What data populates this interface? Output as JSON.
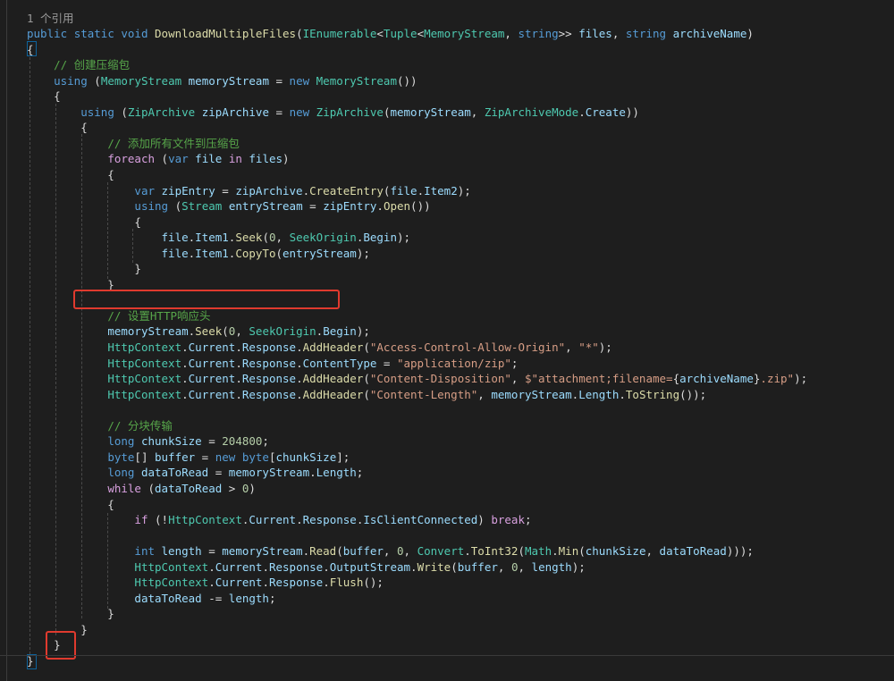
{
  "editor": {
    "codelens": "1 个引用",
    "accent": "#e03a2e",
    "lines": [
      [
        [
          "kw",
          "public"
        ],
        [
          "pl",
          " "
        ],
        [
          "kw",
          "static"
        ],
        [
          "pl",
          " "
        ],
        [
          "kw",
          "void"
        ],
        [
          "pl",
          " "
        ],
        [
          "fn",
          "DownloadMultipleFiles"
        ],
        [
          "pl",
          "("
        ],
        [
          "ty",
          "IEnumerable"
        ],
        [
          "pl",
          "<"
        ],
        [
          "ty",
          "Tuple"
        ],
        [
          "pl",
          "<"
        ],
        [
          "ty",
          "MemoryStream"
        ],
        [
          "pl",
          ", "
        ],
        [
          "kw",
          "string"
        ],
        [
          "pl",
          ">> "
        ],
        [
          "var",
          "files"
        ],
        [
          "pl",
          ", "
        ],
        [
          "kw",
          "string"
        ],
        [
          "pl",
          " "
        ],
        [
          "var",
          "archiveName"
        ],
        [
          "pl",
          ")"
        ]
      ],
      [
        [
          "pl",
          "{"
        ]
      ],
      [
        [
          "pl",
          "    "
        ],
        [
          "cm",
          "// 创建压缩包"
        ]
      ],
      [
        [
          "pl",
          "    "
        ],
        [
          "kw",
          "using"
        ],
        [
          "pl",
          " ("
        ],
        [
          "ty",
          "MemoryStream"
        ],
        [
          "pl",
          " "
        ],
        [
          "var",
          "memoryStream"
        ],
        [
          "pl",
          " = "
        ],
        [
          "kw",
          "new"
        ],
        [
          "pl",
          " "
        ],
        [
          "ty",
          "MemoryStream"
        ],
        [
          "pl",
          "())"
        ]
      ],
      [
        [
          "pl",
          "    {"
        ]
      ],
      [
        [
          "pl",
          "        "
        ],
        [
          "kw",
          "using"
        ],
        [
          "pl",
          " ("
        ],
        [
          "ty",
          "ZipArchive"
        ],
        [
          "pl",
          " "
        ],
        [
          "var",
          "zipArchive"
        ],
        [
          "pl",
          " = "
        ],
        [
          "kw",
          "new"
        ],
        [
          "pl",
          " "
        ],
        [
          "ty",
          "ZipArchive"
        ],
        [
          "pl",
          "("
        ],
        [
          "var",
          "memoryStream"
        ],
        [
          "pl",
          ", "
        ],
        [
          "ty",
          "ZipArchiveMode"
        ],
        [
          "pl",
          "."
        ],
        [
          "var",
          "Create"
        ],
        [
          "pl",
          "))"
        ]
      ],
      [
        [
          "pl",
          "        {"
        ]
      ],
      [
        [
          "pl",
          "            "
        ],
        [
          "cm",
          "// 添加所有文件到压缩包"
        ]
      ],
      [
        [
          "pl",
          "            "
        ],
        [
          "ctl",
          "foreach"
        ],
        [
          "pl",
          " ("
        ],
        [
          "kw",
          "var"
        ],
        [
          "pl",
          " "
        ],
        [
          "var",
          "file"
        ],
        [
          "pl",
          " "
        ],
        [
          "ctl",
          "in"
        ],
        [
          "pl",
          " "
        ],
        [
          "var",
          "files"
        ],
        [
          "pl",
          ")"
        ]
      ],
      [
        [
          "pl",
          "            {"
        ]
      ],
      [
        [
          "pl",
          "                "
        ],
        [
          "kw",
          "var"
        ],
        [
          "pl",
          " "
        ],
        [
          "var",
          "zipEntry"
        ],
        [
          "pl",
          " = "
        ],
        [
          "var",
          "zipArchive"
        ],
        [
          "pl",
          "."
        ],
        [
          "fn",
          "CreateEntry"
        ],
        [
          "pl",
          "("
        ],
        [
          "var",
          "file"
        ],
        [
          "pl",
          "."
        ],
        [
          "var",
          "Item2"
        ],
        [
          "pl",
          ");"
        ]
      ],
      [
        [
          "pl",
          "                "
        ],
        [
          "kw",
          "using"
        ],
        [
          "pl",
          " ("
        ],
        [
          "ty",
          "Stream"
        ],
        [
          "pl",
          " "
        ],
        [
          "var",
          "entryStream"
        ],
        [
          "pl",
          " = "
        ],
        [
          "var",
          "zipEntry"
        ],
        [
          "pl",
          "."
        ],
        [
          "fn",
          "Open"
        ],
        [
          "pl",
          "())"
        ]
      ],
      [
        [
          "pl",
          "                {"
        ]
      ],
      [
        [
          "pl",
          "                    "
        ],
        [
          "var",
          "file"
        ],
        [
          "pl",
          "."
        ],
        [
          "var",
          "Item1"
        ],
        [
          "pl",
          "."
        ],
        [
          "fn",
          "Seek"
        ],
        [
          "pl",
          "("
        ],
        [
          "num",
          "0"
        ],
        [
          "pl",
          ", "
        ],
        [
          "ty",
          "SeekOrigin"
        ],
        [
          "pl",
          "."
        ],
        [
          "var",
          "Begin"
        ],
        [
          "pl",
          ");"
        ]
      ],
      [
        [
          "pl",
          "                    "
        ],
        [
          "var",
          "file"
        ],
        [
          "pl",
          "."
        ],
        [
          "var",
          "Item1"
        ],
        [
          "pl",
          "."
        ],
        [
          "fn",
          "CopyTo"
        ],
        [
          "pl",
          "("
        ],
        [
          "var",
          "entryStream"
        ],
        [
          "pl",
          ");"
        ]
      ],
      [
        [
          "pl",
          "                }"
        ]
      ],
      [
        [
          "pl",
          "            }"
        ]
      ],
      [
        [
          "pl",
          "        "
        ]
      ],
      [
        [
          "pl",
          "            "
        ],
        [
          "cm",
          "// 设置HTTP响应头"
        ]
      ],
      [
        [
          "pl",
          "            "
        ],
        [
          "var",
          "memoryStream"
        ],
        [
          "pl",
          "."
        ],
        [
          "fn",
          "Seek"
        ],
        [
          "pl",
          "("
        ],
        [
          "num",
          "0"
        ],
        [
          "pl",
          ", "
        ],
        [
          "ty",
          "SeekOrigin"
        ],
        [
          "pl",
          "."
        ],
        [
          "var",
          "Begin"
        ],
        [
          "pl",
          ");"
        ]
      ],
      [
        [
          "pl",
          "            "
        ],
        [
          "ty",
          "HttpContext"
        ],
        [
          "pl",
          "."
        ],
        [
          "var",
          "Current"
        ],
        [
          "pl",
          "."
        ],
        [
          "var",
          "Response"
        ],
        [
          "pl",
          "."
        ],
        [
          "fn",
          "AddHeader"
        ],
        [
          "pl",
          "("
        ],
        [
          "str",
          "\"Access-Control-Allow-Origin\""
        ],
        [
          "pl",
          ", "
        ],
        [
          "str",
          "\"*\""
        ],
        [
          "pl",
          ");"
        ]
      ],
      [
        [
          "pl",
          "            "
        ],
        [
          "ty",
          "HttpContext"
        ],
        [
          "pl",
          "."
        ],
        [
          "var",
          "Current"
        ],
        [
          "pl",
          "."
        ],
        [
          "var",
          "Response"
        ],
        [
          "pl",
          "."
        ],
        [
          "var",
          "ContentType"
        ],
        [
          "pl",
          " = "
        ],
        [
          "str",
          "\"application/zip\""
        ],
        [
          "pl",
          ";"
        ]
      ],
      [
        [
          "pl",
          "            "
        ],
        [
          "ty",
          "HttpContext"
        ],
        [
          "pl",
          "."
        ],
        [
          "var",
          "Current"
        ],
        [
          "pl",
          "."
        ],
        [
          "var",
          "Response"
        ],
        [
          "pl",
          "."
        ],
        [
          "fn",
          "AddHeader"
        ],
        [
          "pl",
          "("
        ],
        [
          "str",
          "\"Content-Disposition\""
        ],
        [
          "pl",
          ", "
        ],
        [
          "str",
          "$\"attachment;filename="
        ],
        [
          "pl",
          "{"
        ],
        [
          "var",
          "archiveName"
        ],
        [
          "pl",
          "}"
        ],
        [
          "str",
          ".zip\""
        ],
        [
          "pl",
          ");"
        ]
      ],
      [
        [
          "pl",
          "            "
        ],
        [
          "ty",
          "HttpContext"
        ],
        [
          "pl",
          "."
        ],
        [
          "var",
          "Current"
        ],
        [
          "pl",
          "."
        ],
        [
          "var",
          "Response"
        ],
        [
          "pl",
          "."
        ],
        [
          "fn",
          "AddHeader"
        ],
        [
          "pl",
          "("
        ],
        [
          "str",
          "\"Content-Length\""
        ],
        [
          "pl",
          ", "
        ],
        [
          "var",
          "memoryStream"
        ],
        [
          "pl",
          "."
        ],
        [
          "var",
          "Length"
        ],
        [
          "pl",
          "."
        ],
        [
          "fn",
          "ToString"
        ],
        [
          "pl",
          "());"
        ]
      ],
      [
        [
          "pl",
          ""
        ]
      ],
      [
        [
          "pl",
          "            "
        ],
        [
          "cm",
          "// 分块传输"
        ]
      ],
      [
        [
          "pl",
          "            "
        ],
        [
          "kw",
          "long"
        ],
        [
          "pl",
          " "
        ],
        [
          "var",
          "chunkSize"
        ],
        [
          "pl",
          " = "
        ],
        [
          "num",
          "204800"
        ],
        [
          "pl",
          ";"
        ]
      ],
      [
        [
          "pl",
          "            "
        ],
        [
          "kw",
          "byte"
        ],
        [
          "pl",
          "[] "
        ],
        [
          "var",
          "buffer"
        ],
        [
          "pl",
          " = "
        ],
        [
          "kw",
          "new"
        ],
        [
          "pl",
          " "
        ],
        [
          "kw",
          "byte"
        ],
        [
          "pl",
          "["
        ],
        [
          "var",
          "chunkSize"
        ],
        [
          "pl",
          "];"
        ]
      ],
      [
        [
          "pl",
          "            "
        ],
        [
          "kw",
          "long"
        ],
        [
          "pl",
          " "
        ],
        [
          "var",
          "dataToRead"
        ],
        [
          "pl",
          " = "
        ],
        [
          "var",
          "memoryStream"
        ],
        [
          "pl",
          "."
        ],
        [
          "var",
          "Length"
        ],
        [
          "pl",
          ";"
        ]
      ],
      [
        [
          "pl",
          "            "
        ],
        [
          "ctl",
          "while"
        ],
        [
          "pl",
          " ("
        ],
        [
          "var",
          "dataToRead"
        ],
        [
          "pl",
          " > "
        ],
        [
          "num",
          "0"
        ],
        [
          "pl",
          ")"
        ]
      ],
      [
        [
          "pl",
          "            {"
        ]
      ],
      [
        [
          "pl",
          "                "
        ],
        [
          "ctl",
          "if"
        ],
        [
          "pl",
          " (!"
        ],
        [
          "ty",
          "HttpContext"
        ],
        [
          "pl",
          "."
        ],
        [
          "var",
          "Current"
        ],
        [
          "pl",
          "."
        ],
        [
          "var",
          "Response"
        ],
        [
          "pl",
          "."
        ],
        [
          "var",
          "IsClientConnected"
        ],
        [
          "pl",
          ") "
        ],
        [
          "ctl",
          "break"
        ],
        [
          "pl",
          ";"
        ]
      ],
      [
        [
          "pl",
          ""
        ]
      ],
      [
        [
          "pl",
          "                "
        ],
        [
          "kw",
          "int"
        ],
        [
          "pl",
          " "
        ],
        [
          "var",
          "length"
        ],
        [
          "pl",
          " = "
        ],
        [
          "var",
          "memoryStream"
        ],
        [
          "pl",
          "."
        ],
        [
          "fn",
          "Read"
        ],
        [
          "pl",
          "("
        ],
        [
          "var",
          "buffer"
        ],
        [
          "pl",
          ", "
        ],
        [
          "num",
          "0"
        ],
        [
          "pl",
          ", "
        ],
        [
          "ty",
          "Convert"
        ],
        [
          "pl",
          "."
        ],
        [
          "fn",
          "ToInt32"
        ],
        [
          "pl",
          "("
        ],
        [
          "ty",
          "Math"
        ],
        [
          "pl",
          "."
        ],
        [
          "fn",
          "Min"
        ],
        [
          "pl",
          "("
        ],
        [
          "var",
          "chunkSize"
        ],
        [
          "pl",
          ", "
        ],
        [
          "var",
          "dataToRead"
        ],
        [
          "pl",
          ")));"
        ]
      ],
      [
        [
          "pl",
          "                "
        ],
        [
          "ty",
          "HttpContext"
        ],
        [
          "pl",
          "."
        ],
        [
          "var",
          "Current"
        ],
        [
          "pl",
          "."
        ],
        [
          "var",
          "Response"
        ],
        [
          "pl",
          "."
        ],
        [
          "var",
          "OutputStream"
        ],
        [
          "pl",
          "."
        ],
        [
          "fn",
          "Write"
        ],
        [
          "pl",
          "("
        ],
        [
          "var",
          "buffer"
        ],
        [
          "pl",
          ", "
        ],
        [
          "num",
          "0"
        ],
        [
          "pl",
          ", "
        ],
        [
          "var",
          "length"
        ],
        [
          "pl",
          ");"
        ]
      ],
      [
        [
          "pl",
          "                "
        ],
        [
          "ty",
          "HttpContext"
        ],
        [
          "pl",
          "."
        ],
        [
          "var",
          "Current"
        ],
        [
          "pl",
          "."
        ],
        [
          "var",
          "Response"
        ],
        [
          "pl",
          "."
        ],
        [
          "fn",
          "Flush"
        ],
        [
          "pl",
          "();"
        ]
      ],
      [
        [
          "pl",
          "                "
        ],
        [
          "var",
          "dataToRead"
        ],
        [
          "pl",
          " -= "
        ],
        [
          "var",
          "length"
        ],
        [
          "pl",
          ";"
        ]
      ],
      [
        [
          "pl",
          "            }"
        ]
      ],
      [
        [
          "pl",
          "        }"
        ]
      ],
      [
        [
          "pl",
          "    }"
        ]
      ],
      [
        [
          "pl",
          "}"
        ]
      ]
    ]
  }
}
